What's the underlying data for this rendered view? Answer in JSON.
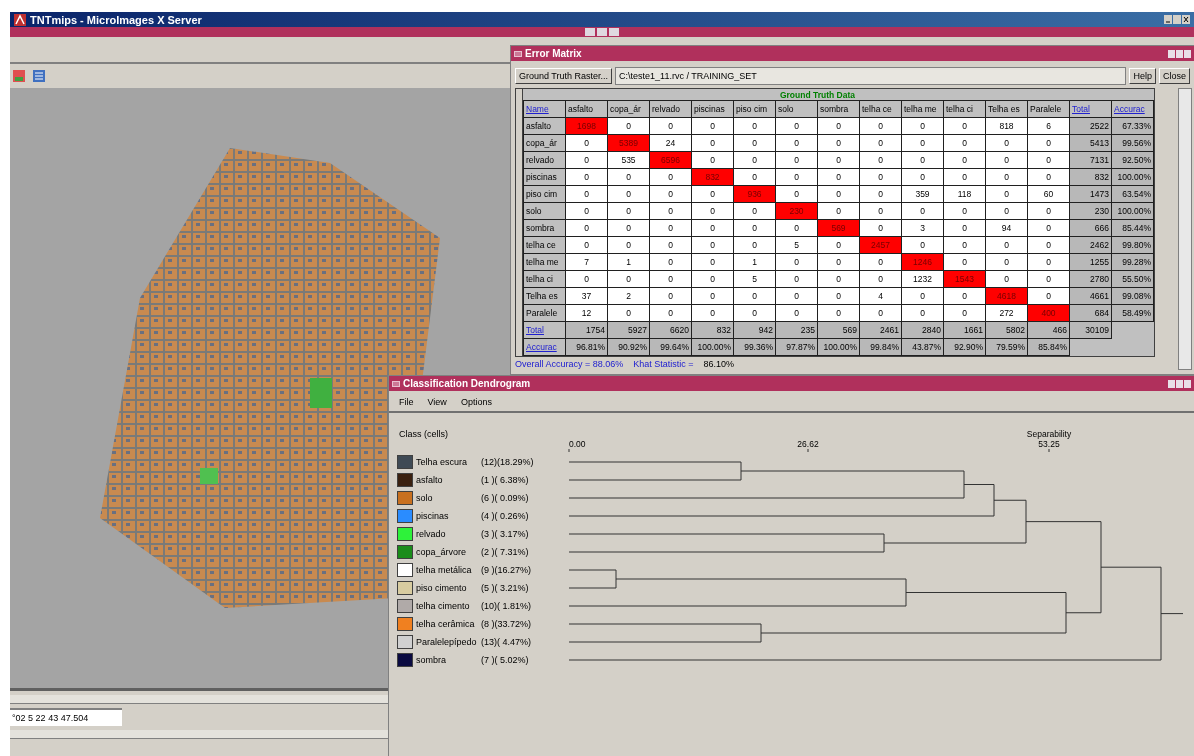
{
  "main_window": {
    "title": "TNTmips - MicroImages X Server",
    "status": "°02 5 22 43 47.504"
  },
  "error_matrix": {
    "title": "Error Matrix",
    "raster_button": "Ground Truth Raster...",
    "raster_path": "C:\\teste1_11.rvc / TRAINING_SET",
    "buttons": [
      "Help",
      "Close"
    ],
    "group_header": "Ground Truth Data",
    "corner": "Name",
    "columns": [
      "asfalto",
      "copa_ár",
      "relvado",
      "piscinas",
      "piso cim",
      "solo",
      "sombra",
      "telha ce",
      "telha me",
      "telha ci",
      "Telha es",
      "Paralele"
    ],
    "total_header": "Total",
    "accuracy_header": "Accurac",
    "rows": [
      {
        "name": "asfalto",
        "cells": [
          "1698",
          "0",
          "0",
          "0",
          "0",
          "0",
          "0",
          "0",
          "0",
          "0",
          "818",
          "6"
        ],
        "highlighted": [
          true,
          false,
          false,
          false,
          false,
          false,
          false,
          false,
          false,
          false,
          false,
          false
        ],
        "total": "2522",
        "accuracy": "67.33%"
      },
      {
        "name": "copa_ár",
        "cells": [
          "0",
          "5389",
          "24",
          "0",
          "0",
          "0",
          "0",
          "0",
          "0",
          "0",
          "0",
          "0"
        ],
        "highlighted": [
          false,
          true,
          false,
          false,
          false,
          false,
          false,
          false,
          false,
          false,
          false,
          false
        ],
        "total": "5413",
        "accuracy": "99.56%"
      },
      {
        "name": "relvado",
        "cells": [
          "0",
          "535",
          "6596",
          "0",
          "0",
          "0",
          "0",
          "0",
          "0",
          "0",
          "0",
          "0"
        ],
        "highlighted": [
          false,
          false,
          true,
          false,
          false,
          false,
          false,
          false,
          false,
          false,
          false,
          false
        ],
        "total": "7131",
        "accuracy": "92.50%"
      },
      {
        "name": "piscinas",
        "cells": [
          "0",
          "0",
          "0",
          "832",
          "0",
          "0",
          "0",
          "0",
          "0",
          "0",
          "0",
          "0"
        ],
        "highlighted": [
          false,
          false,
          false,
          true,
          false,
          false,
          false,
          false,
          false,
          false,
          false,
          false
        ],
        "total": "832",
        "accuracy": "100.00%"
      },
      {
        "name": "piso cim",
        "cells": [
          "0",
          "0",
          "0",
          "0",
          "936",
          "0",
          "0",
          "0",
          "359",
          "118",
          "0",
          "60"
        ],
        "highlighted": [
          false,
          false,
          false,
          false,
          true,
          false,
          false,
          false,
          false,
          false,
          false,
          false
        ],
        "total": "1473",
        "accuracy": "63.54%"
      },
      {
        "name": "solo",
        "cells": [
          "0",
          "0",
          "0",
          "0",
          "0",
          "230",
          "0",
          "0",
          "0",
          "0",
          "0",
          "0"
        ],
        "highlighted": [
          false,
          false,
          false,
          false,
          false,
          true,
          false,
          false,
          false,
          false,
          false,
          false
        ],
        "total": "230",
        "accuracy": "100.00%"
      },
      {
        "name": "sombra",
        "cells": [
          "0",
          "0",
          "0",
          "0",
          "0",
          "0",
          "569",
          "0",
          "3",
          "0",
          "94",
          "0"
        ],
        "highlighted": [
          false,
          false,
          false,
          false,
          false,
          false,
          true,
          false,
          false,
          false,
          false,
          false
        ],
        "total": "666",
        "accuracy": "85.44%"
      },
      {
        "name": "telha ce",
        "cells": [
          "0",
          "0",
          "0",
          "0",
          "0",
          "5",
          "0",
          "2457",
          "0",
          "0",
          "0",
          "0"
        ],
        "highlighted": [
          false,
          false,
          false,
          false,
          false,
          false,
          false,
          true,
          false,
          false,
          false,
          false
        ],
        "total": "2462",
        "accuracy": "99.80%"
      },
      {
        "name": "telha me",
        "cells": [
          "7",
          "1",
          "0",
          "0",
          "1",
          "0",
          "0",
          "0",
          "1246",
          "0",
          "0",
          "0"
        ],
        "highlighted": [
          false,
          false,
          false,
          false,
          false,
          false,
          false,
          false,
          true,
          false,
          false,
          false
        ],
        "total": "1255",
        "accuracy": "99.28%"
      },
      {
        "name": "telha ci",
        "cells": [
          "0",
          "0",
          "0",
          "0",
          "5",
          "0",
          "0",
          "0",
          "1232",
          "1543",
          "0",
          "0"
        ],
        "highlighted": [
          false,
          false,
          false,
          false,
          false,
          false,
          false,
          false,
          false,
          true,
          false,
          false
        ],
        "total": "2780",
        "accuracy": "55.50%"
      },
      {
        "name": "Telha es",
        "cells": [
          "37",
          "2",
          "0",
          "0",
          "0",
          "0",
          "0",
          "4",
          "0",
          "0",
          "4618",
          "0"
        ],
        "highlighted": [
          false,
          false,
          false,
          false,
          false,
          false,
          false,
          false,
          false,
          false,
          true,
          false
        ],
        "total": "4661",
        "accuracy": "99.08%"
      },
      {
        "name": "Paralele",
        "cells": [
          "12",
          "0",
          "0",
          "0",
          "0",
          "0",
          "0",
          "0",
          "0",
          "0",
          "272",
          "400"
        ],
        "highlighted": [
          false,
          false,
          false,
          false,
          false,
          false,
          false,
          false,
          false,
          false,
          false,
          true
        ],
        "total": "684",
        "accuracy": "58.49%"
      }
    ],
    "total_row": {
      "label": "Total",
      "cells": [
        "1754",
        "5927",
        "6620",
        "832",
        "942",
        "235",
        "569",
        "2461",
        "2840",
        "1661",
        "5802",
        "466",
        "30109"
      ]
    },
    "accuracy_row": {
      "label": "Accurac",
      "cells": [
        "96.81%",
        "90.92%",
        "99.64%",
        "100.00%",
        "99.36%",
        "97.87%",
        "100.00%",
        "99.84%",
        "43.87%",
        "92.90%",
        "79.59%",
        "85.84%"
      ]
    },
    "overall": "Overall Accuracy = 88.06%",
    "khat_label": "Khat Statistic =",
    "khat_value": "86.10%"
  },
  "dendrogram": {
    "title": "Classification Dendrogram",
    "menu": [
      "File",
      "View",
      "Options"
    ],
    "legend_title": "Class (cells)",
    "axis_title": "Separability",
    "ticks": [
      "0.00",
      "26.62",
      "53.25"
    ],
    "classes": [
      {
        "name": "Telha escura",
        "stats": "(12)(18.29%)",
        "color": "#3f4a55"
      },
      {
        "name": "asfalto",
        "stats": "(1 )( 6.38%)",
        "color": "#3a2010"
      },
      {
        "name": "solo",
        "stats": "(6 )( 0.09%)",
        "color": "#c8701f"
      },
      {
        "name": "piscinas",
        "stats": "(4 )( 0.26%)",
        "color": "#2a8cff"
      },
      {
        "name": "relvado",
        "stats": "(3 )( 3.17%)",
        "color": "#2ef23a"
      },
      {
        "name": "copa_árvore",
        "stats": "(2 )( 7.31%)",
        "color": "#1a8c1a"
      },
      {
        "name": "telha metálica",
        "stats": "(9 )(16.27%)",
        "color": "#ffffff"
      },
      {
        "name": "piso cimento",
        "stats": "(5 )( 3.21%)",
        "color": "#d8cca0"
      },
      {
        "name": "telha cimento",
        "stats": "(10)( 1.81%)",
        "color": "#b0aaa8"
      },
      {
        "name": "telha cerâmica",
        "stats": "(8 )(33.72%)",
        "color": "#f08020"
      },
      {
        "name": "Paralelepípedo",
        "stats": "(13)( 4.47%)",
        "color": "#d0d0d0"
      },
      {
        "name": "sombra",
        "stats": "(7 )( 5.02%)",
        "color": "#0a0a40"
      }
    ]
  }
}
